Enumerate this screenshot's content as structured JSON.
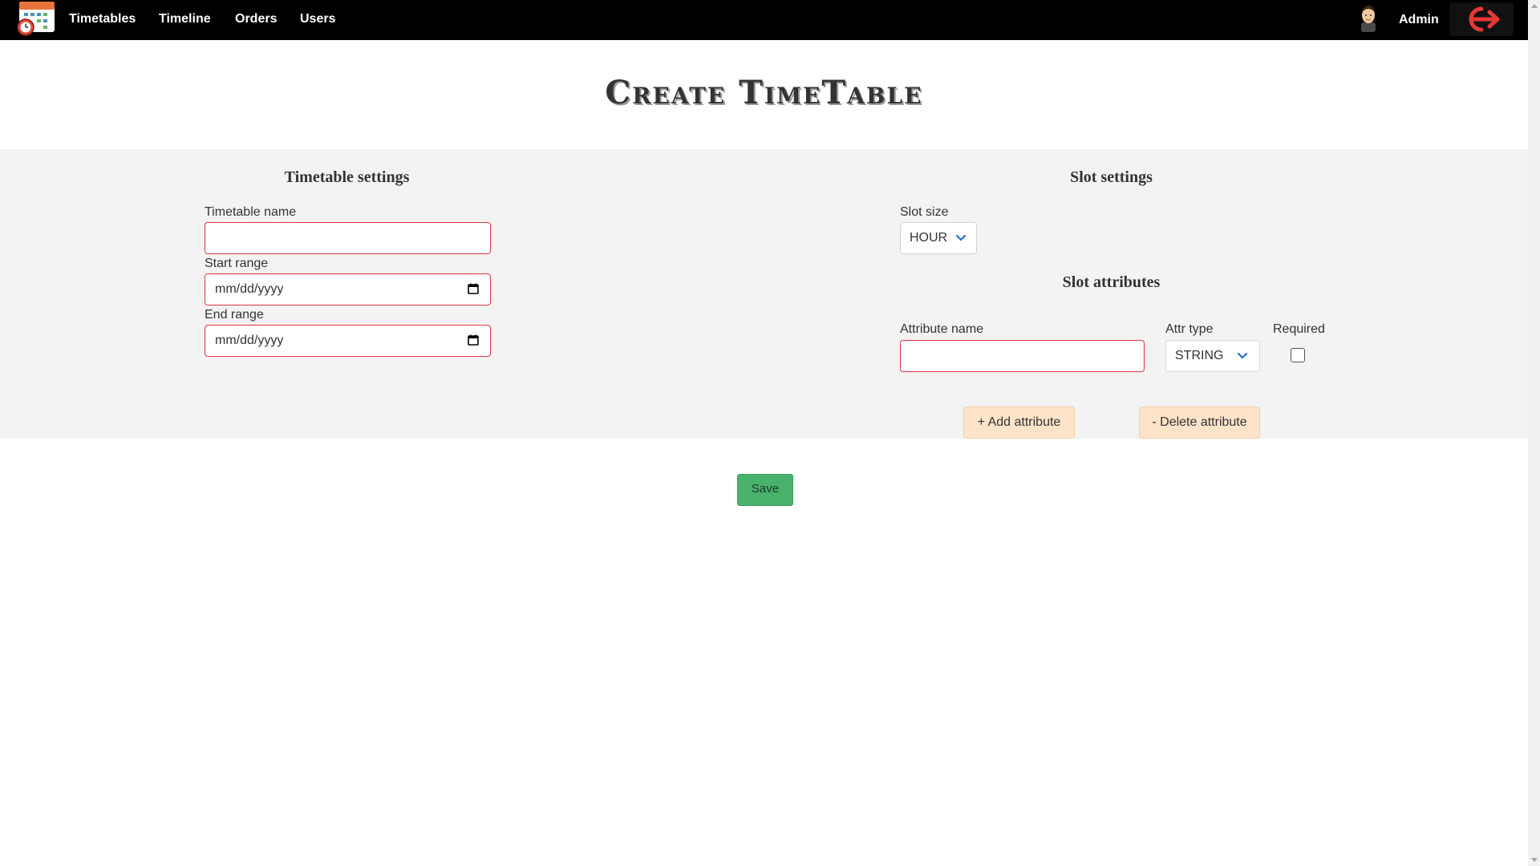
{
  "nav": {
    "links": [
      "Timetables",
      "Timeline",
      "Orders",
      "Users"
    ],
    "user_name": "Admin"
  },
  "page": {
    "title": "Create TimeTable"
  },
  "timetable_settings": {
    "heading": "Timetable settings",
    "name_label": "Timetable name",
    "name_value": "",
    "start_label": "Start range",
    "start_placeholder": "mm/dd/yyyy",
    "end_label": "End range",
    "end_placeholder": "mm/dd/yyyy"
  },
  "slot_settings": {
    "heading": "Slot settings",
    "slot_size_label": "Slot size",
    "slot_size_value": "HOUR",
    "attributes_heading": "Slot attributes",
    "attr_name_label": "Attribute name",
    "attr_name_value": "",
    "attr_type_label": "Attr type",
    "attr_type_value": "STRING",
    "required_label": "Required",
    "required_checked": false,
    "add_button": "+ Add attribute",
    "delete_button": "- Delete attribute"
  },
  "actions": {
    "save": "Save"
  },
  "colors": {
    "navbar": "#000000",
    "band": "#f3f3f3",
    "invalid_border": "#dc3545",
    "attr_button": "#fde3c8",
    "save_button": "#48b26c",
    "logout_icon": "#e53935",
    "select_chevron": "#1e6fd9"
  },
  "icons": {
    "logo": "calendar-clock-icon",
    "avatar": "user-avatar-icon",
    "logout": "logout-arrow-icon",
    "calendar": "calendar-icon",
    "dropdown": "chevron-down-icon"
  }
}
